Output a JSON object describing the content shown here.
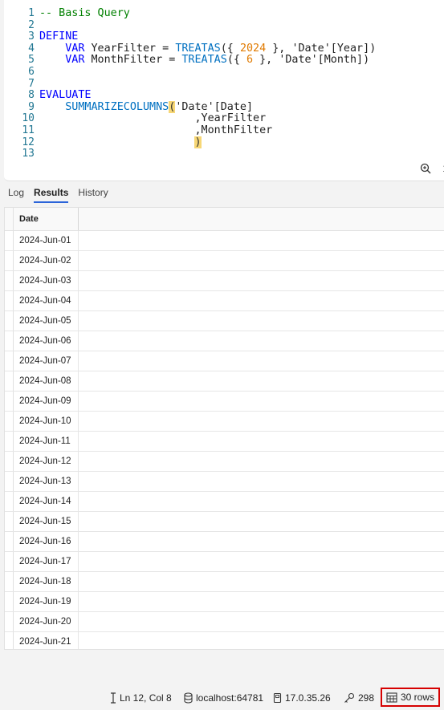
{
  "editor": {
    "lines": [
      {
        "num": "1",
        "tokens": [
          {
            "t": "-- Basis Query",
            "c": "tok-comment"
          }
        ]
      },
      {
        "num": "2",
        "tokens": []
      },
      {
        "num": "3",
        "tokens": [
          {
            "t": "DEFINE",
            "c": "tok-kw"
          }
        ]
      },
      {
        "num": "4",
        "tokens": [
          {
            "t": "    VAR ",
            "c": "tok-kw"
          },
          {
            "t": "YearFilter = ",
            "c": "tok-plain"
          },
          {
            "t": "TREATAS",
            "c": "tok-fnc"
          },
          {
            "t": "({ ",
            "c": "tok-plain"
          },
          {
            "t": "2024",
            "c": "tok-num"
          },
          {
            "t": " }, ",
            "c": "tok-plain"
          },
          {
            "t": "'Date'[Year]",
            "c": "tok-plain"
          },
          {
            "t": ")",
            "c": "tok-plain"
          }
        ]
      },
      {
        "num": "5",
        "tokens": [
          {
            "t": "    VAR ",
            "c": "tok-kw"
          },
          {
            "t": "MonthFilter = ",
            "c": "tok-plain"
          },
          {
            "t": "TREATAS",
            "c": "tok-fnc"
          },
          {
            "t": "({ ",
            "c": "tok-plain"
          },
          {
            "t": "6",
            "c": "tok-num"
          },
          {
            "t": " }, ",
            "c": "tok-plain"
          },
          {
            "t": "'Date'[Month]",
            "c": "tok-plain"
          },
          {
            "t": ")",
            "c": "tok-plain"
          }
        ]
      },
      {
        "num": "6",
        "tokens": []
      },
      {
        "num": "7",
        "tokens": []
      },
      {
        "num": "8",
        "tokens": [
          {
            "t": "EVALUATE",
            "c": "tok-kw"
          }
        ]
      },
      {
        "num": "9",
        "tokens": [
          {
            "t": "    SUMMARIZECOLUMNS",
            "c": "tok-fnc"
          },
          {
            "t": "(",
            "c": "tok-brk"
          },
          {
            "t": "'Date'[Date]",
            "c": "tok-plain"
          }
        ]
      },
      {
        "num": "10",
        "tokens": [
          {
            "t": "                        ,YearFilter",
            "c": "tok-plain"
          }
        ]
      },
      {
        "num": "11",
        "tokens": [
          {
            "t": "                        ,MonthFilter",
            "c": "tok-plain"
          }
        ]
      },
      {
        "num": "12",
        "tokens": [
          {
            "t": "                        ",
            "c": "tok-plain"
          },
          {
            "t": ")",
            "c": "tok-brk"
          }
        ]
      },
      {
        "num": "13",
        "tokens": []
      }
    ],
    "zoom_label": "1"
  },
  "tabs": [
    {
      "label": "Log",
      "active": false
    },
    {
      "label": "Results",
      "active": true
    },
    {
      "label": "History",
      "active": false
    }
  ],
  "grid": {
    "header": "Date",
    "rows": [
      "2024-Jun-01",
      "2024-Jun-02",
      "2024-Jun-03",
      "2024-Jun-04",
      "2024-Jun-05",
      "2024-Jun-06",
      "2024-Jun-07",
      "2024-Jun-08",
      "2024-Jun-09",
      "2024-Jun-10",
      "2024-Jun-11",
      "2024-Jun-12",
      "2024-Jun-13",
      "2024-Jun-14",
      "2024-Jun-15",
      "2024-Jun-16",
      "2024-Jun-17",
      "2024-Jun-18",
      "2024-Jun-19",
      "2024-Jun-20",
      "2024-Jun-21"
    ]
  },
  "status": {
    "cursor": "Ln 12, Col 8",
    "server": "localhost:64781",
    "version": "17.0.35.26",
    "spid": "298",
    "rows": "30 rows"
  }
}
